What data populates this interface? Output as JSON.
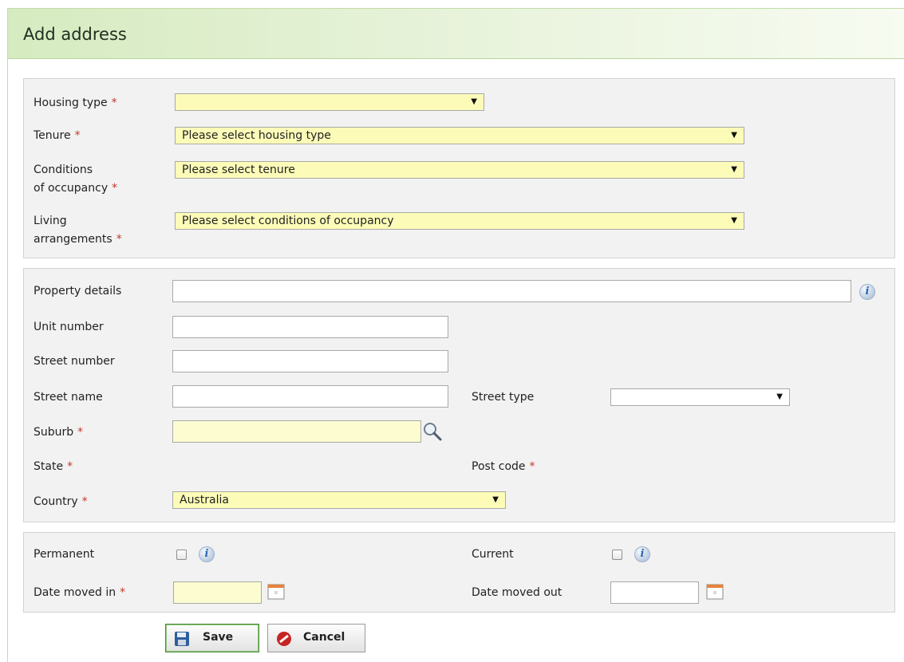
{
  "header": {
    "title": "Add address"
  },
  "housing_section": {
    "housing_type": {
      "label": "Housing type",
      "value": ""
    },
    "tenure": {
      "label": "Tenure",
      "value": "Please select housing type"
    },
    "conditions_of_occupancy": {
      "label_line1": "Conditions",
      "label_line2": "of occupancy",
      "value": "Please select tenure"
    },
    "living_arrangements": {
      "label_line1": "Living",
      "label_line2": "arrangements",
      "value": "Please select conditions of occupancy"
    }
  },
  "address_section": {
    "property_details": {
      "label": "Property details",
      "value": ""
    },
    "unit_number": {
      "label": "Unit number",
      "value": ""
    },
    "street_number": {
      "label": "Street number",
      "value": ""
    },
    "street_name": {
      "label": "Street name",
      "value": ""
    },
    "street_type": {
      "label": "Street type",
      "value": ""
    },
    "suburb": {
      "label": "Suburb",
      "value": ""
    },
    "state": {
      "label": "State"
    },
    "post_code": {
      "label": "Post code"
    },
    "country": {
      "label": "Country",
      "value": "Australia"
    }
  },
  "status_section": {
    "permanent": {
      "label": "Permanent",
      "checked": false
    },
    "current": {
      "label": "Current",
      "checked": false
    },
    "date_moved_in": {
      "label": "Date moved in",
      "value": ""
    },
    "date_moved_out": {
      "label": "Date moved out",
      "value": ""
    }
  },
  "required_marker": "*",
  "info_glyph": "i",
  "dropdown_arrow": "▼",
  "buttons": {
    "save": "Save",
    "cancel": "Cancel"
  },
  "icons": {
    "info": "info-icon",
    "calendar": "calendar-icon",
    "search": "magnifier-icon",
    "save": "floppy-disk-icon",
    "cancel": "no-entry-icon"
  },
  "colors": {
    "required": "#c0392b",
    "required_field_bg": "#fcfcb8",
    "panel_bg": "#f2f2f2",
    "header_gradient_start": "#d6ebc0",
    "save_border": "#4b8a3a",
    "cancel_icon": "#c72424"
  }
}
